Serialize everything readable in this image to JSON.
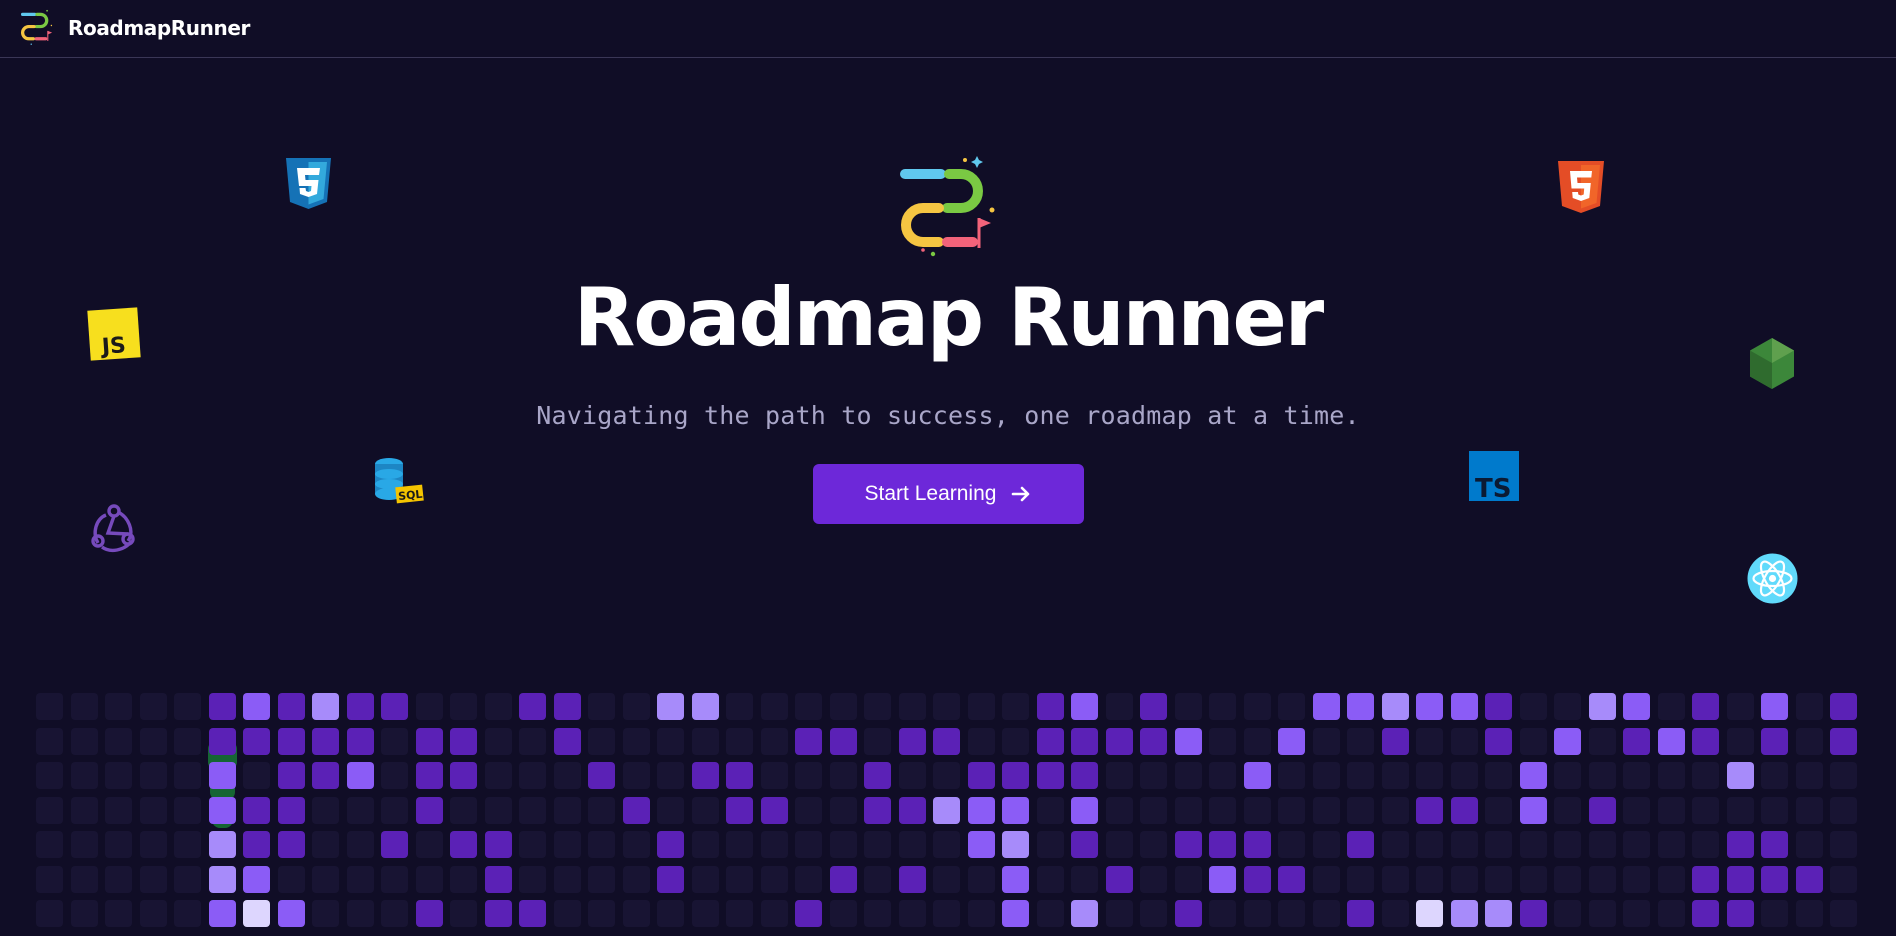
{
  "header": {
    "brand_name": "RoadmapRunner",
    "logo_icon": "roadmap-runner-logo-icon"
  },
  "hero": {
    "title": "Roadmap Runner",
    "subtitle": "Navigating the path to success, one roadmap at a time.",
    "cta_label": "Start Learning",
    "cta_icon": "arrow-right-icon"
  },
  "floating_icons": [
    "css3-icon",
    "javascript-icon",
    "sql-database-icon",
    "redux-icon",
    "html5-icon",
    "nodejs-icon",
    "typescript-icon",
    "react-icon"
  ],
  "colors": {
    "background": "#100d26",
    "accent": "#6d28d9",
    "cell_empty": "#181433",
    "cell_low": "#5b21b6",
    "cell_mid": "#8b5cf6",
    "cell_high": "#a78bfa",
    "cell_max": "#ddd6fe",
    "streak_green": "#166534"
  },
  "activity_grid": {
    "columns": 53,
    "rows": 7,
    "levels": [
      "00000121311000110033000000000120100002232210032010201101020001",
      "00000111110110010000001101100111120020010010201210101000001",
      "00000201120110001001100010011110000200000002000003000000002",
      "00000211000100000100110011322020000000001102010000000000001",
      "00000311001011000010000000023010011100100000000001100000001",
      "00000320000001000010000101002001002110000000000011110000000",
      "00000242000101100000001000002030010000104331000011000010000"
    ]
  }
}
